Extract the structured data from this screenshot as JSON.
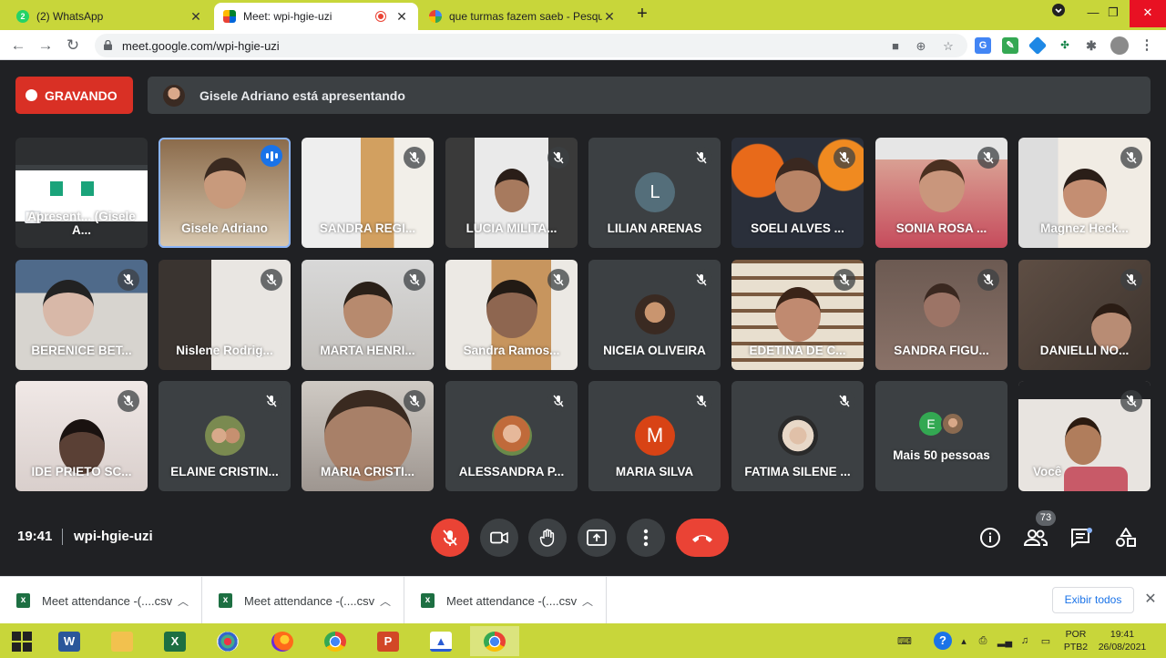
{
  "browser": {
    "tabs": [
      {
        "title": "(2) WhatsApp",
        "badge": "2"
      },
      {
        "title": "Meet: wpi-hgie-uzi"
      },
      {
        "title": "que turmas fazem saeb - Pesquis"
      }
    ],
    "new_tab": "+",
    "url": "meet.google.com/wpi-hgie-uzi"
  },
  "meet": {
    "recording_label": "GRAVANDO",
    "presenting_text": "Gisele Adriano está apresentando",
    "participants": [
      {
        "name": "Apresent... (Gisele A..."
      },
      {
        "name": "Gisele Adriano"
      },
      {
        "name": "SANDRA REGI..."
      },
      {
        "name": "LUCIA MILITA..."
      },
      {
        "name": "LILIAN ARENAS",
        "initial": "L"
      },
      {
        "name": "SOELI ALVES ..."
      },
      {
        "name": "SONIA ROSA ..."
      },
      {
        "name": "Magnez Heck..."
      },
      {
        "name": "BERENICE BET..."
      },
      {
        "name": "Nislene Rodrig..."
      },
      {
        "name": "MARTA HENRI..."
      },
      {
        "name": "Sandra Ramos..."
      },
      {
        "name": "NICEIA OLIVEIRA"
      },
      {
        "name": "EDETINA DE C..."
      },
      {
        "name": "SANDRA FIGU..."
      },
      {
        "name": "DANIELLI NO..."
      },
      {
        "name": "IDE PRIETO SC..."
      },
      {
        "name": "ELAINE CRISTIN..."
      },
      {
        "name": "MARIA CRISTI..."
      },
      {
        "name": "ALESSANDRA P..."
      },
      {
        "name": "MARIA SILVA",
        "initial": "M"
      },
      {
        "name": "FATIMA SILENE ..."
      },
      {
        "name": "Mais 50 pessoas",
        "initial": "E"
      },
      {
        "name": "Você"
      }
    ],
    "time": "19:41",
    "meeting_code": "wpi-hgie-uzi",
    "people_count": "73"
  },
  "downloads": {
    "items": [
      "Meet attendance -(....csv",
      "Meet attendance -(....csv",
      "Meet attendance -(....csv"
    ],
    "show_all": "Exibir todos"
  },
  "taskbar": {
    "lang_top": "POR",
    "lang_bottom": "PTB2",
    "time": "19:41",
    "date": "26/08/2021"
  },
  "colors": {
    "accent": "#c8d63a",
    "recording": "#d93025",
    "hangup": "#ea4335",
    "tile_bg": "#3c4043",
    "speaking": "#8ab4f8"
  }
}
